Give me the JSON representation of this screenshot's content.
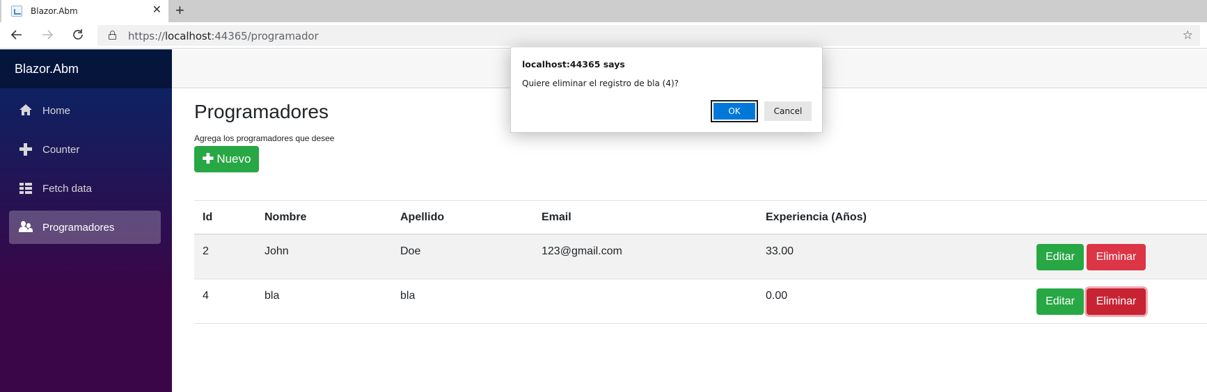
{
  "browser": {
    "tab_title": "Blazor.Abm",
    "tab_close": "✕",
    "new_tab": "+",
    "url_prefix": "https://",
    "url_host": "localhost",
    "url_rest": ":44365/programador"
  },
  "sidebar": {
    "brand": "Blazor.Abm",
    "items": [
      {
        "label": "Home",
        "icon": "home-icon",
        "active": false
      },
      {
        "label": "Counter",
        "icon": "plus-icon",
        "active": false
      },
      {
        "label": "Fetch data",
        "icon": "list-icon",
        "active": false
      },
      {
        "label": "Programadores",
        "icon": "people-icon",
        "active": true
      }
    ]
  },
  "main": {
    "title": "Programadores",
    "subtitle": "Agrega los programadores que desee",
    "new_button": "Nuevo",
    "table": {
      "headers": [
        "Id",
        "Nombre",
        "Apellido",
        "Email",
        "Experiencia (Años)"
      ],
      "rows": [
        {
          "id": "2",
          "nombre": "John",
          "apellido": "Doe",
          "email": "123@gmail.com",
          "experiencia": "33.00"
        },
        {
          "id": "4",
          "nombre": "bla",
          "apellido": "bla",
          "email": "",
          "experiencia": "0.00"
        }
      ],
      "edit_label": "Editar",
      "delete_label": "Eliminar"
    }
  },
  "dialog": {
    "title": "localhost:44365 says",
    "message": "Quiere eliminar el registro de bla (4)?",
    "ok_label": "OK",
    "cancel_label": "Cancel"
  },
  "colors": {
    "success": "#28a745",
    "danger": "#dc3545",
    "dialog_primary": "#0078d7",
    "sidebar_top": "#052767",
    "sidebar_bottom": "#3a0647"
  }
}
